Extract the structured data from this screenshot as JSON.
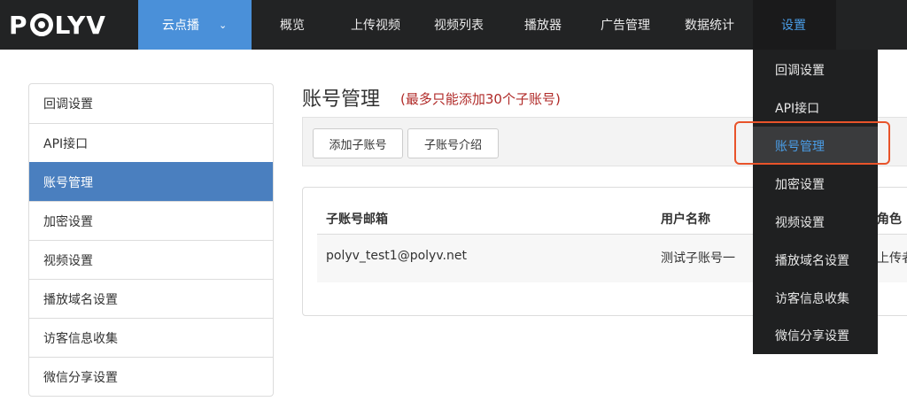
{
  "brand": {
    "logo_text_left": "P",
    "logo_text_right": "LYV"
  },
  "nav": {
    "product_label": "云点播",
    "items": [
      "概览",
      "上传视频",
      "视频列表",
      "播放器",
      "广告管理",
      "数据统计",
      "设置"
    ],
    "active_color": "#4a9ee8",
    "product_bg": "#4a90d9"
  },
  "sidebar": {
    "items": [
      "回调设置",
      "API接口",
      "账号管理",
      "加密设置",
      "视频设置",
      "播放域名设置",
      "访客信息收集",
      "微信分享设置"
    ],
    "active_index": 2
  },
  "main": {
    "title": "账号管理",
    "note": "(最多只能添加30个子账号)",
    "buttons": {
      "add": "添加子账号",
      "intro": "子账号介绍"
    },
    "table": {
      "headers": [
        "子账号邮箱",
        "用户名称",
        "角色"
      ],
      "rows": [
        {
          "email": "polyv_test1@polyv.net",
          "name": "测试子账号一",
          "role": "上传者"
        }
      ]
    }
  },
  "dropdown": {
    "items": [
      "回调设置",
      "API接口",
      "账号管理",
      "加密设置",
      "视频设置",
      "播放域名设置",
      "访客信息收集",
      "微信分享设置"
    ],
    "active_index": 2,
    "highlight_color": "#e8532a"
  }
}
